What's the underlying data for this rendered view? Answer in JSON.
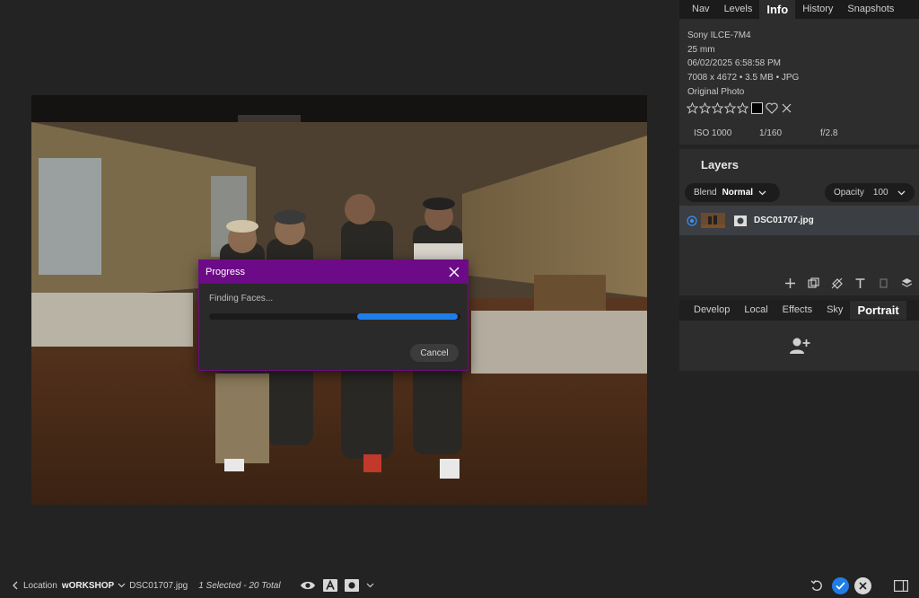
{
  "dialog": {
    "title": "Progress",
    "status": "Finding Faces...",
    "progress": 0.4,
    "progress_start": 0.59,
    "cancel_label": "Cancel"
  },
  "top_tabs": {
    "nav": "Nav",
    "levels": "Levels",
    "info": "Info",
    "history": "History",
    "snapshots": "Snapshots"
  },
  "info": {
    "camera": "Sony ILCE-7M4",
    "focal_length": "25 mm",
    "datetime": "06/02/2025 6:58:58 PM",
    "dimensions": "7008 x 4672  •  3.5 MB  •  JPG",
    "label": "Original Photo",
    "stars_filled": 0,
    "iso": "ISO 1000",
    "shutter": "1/160",
    "aperture": "f/2.8"
  },
  "layers": {
    "title": "Layers",
    "blend_label": "Blend",
    "blend_value": "Normal",
    "opacity_label": "Opacity",
    "opacity_value": "100",
    "layer_name": "DSC01707.jpg"
  },
  "edit_tabs": {
    "develop": "Develop",
    "local": "Local",
    "effects": "Effects",
    "sky": "Sky",
    "portrait": "Portrait"
  },
  "statusbar": {
    "location_label": "Location",
    "location_value": "wORKSHOP",
    "filename": "DSC01707.jpg",
    "selection": "1 Selected - 20 Total"
  },
  "colors": {
    "accent": "#1f7de8",
    "dialog_header": "#6d0a87"
  },
  "icons": {
    "close": "close-icon",
    "add_face": "add-person-icon",
    "eye": "eye-icon",
    "undo": "undo-icon",
    "check": "check-icon",
    "reject": "x-icon"
  }
}
